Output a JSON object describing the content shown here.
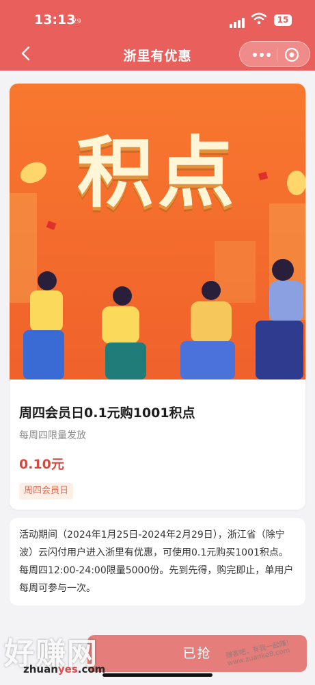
{
  "status_bar": {
    "time": "13:13",
    "time_sub": "29",
    "battery": "15"
  },
  "nav": {
    "title": "浙里有优惠"
  },
  "banner": {
    "headline": "积点"
  },
  "product": {
    "title": "周四会员日0.1元购1001积点",
    "subtitle": "每周四限量发放",
    "price": "0.10元",
    "tag": "周四会员日"
  },
  "description": "活动期间（2024年1月25日-2024年2月29日），浙江省（除宁波）云闪付用户进入浙里有优惠，可使用0.1元购买1001积点。每周四12:00-24:00限量5000份。先到先得，购完即止，单用户每周可参与一次。",
  "action": {
    "button_label": "已抢"
  },
  "watermark": {
    "main": "好赚网",
    "sub_prefix": "zhuan",
    "sub_mid": "yes",
    "sub_suffix": ".com",
    "corner": "赚客吧，有我一起赚！ www.zuanke8.com"
  },
  "colors": {
    "brand": "#e95f5b",
    "price": "#d8483f",
    "button_disabled": "#e57e7a"
  }
}
